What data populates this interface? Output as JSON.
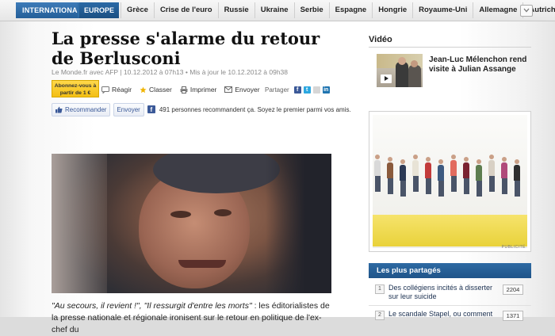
{
  "nav": {
    "section": "INTERNATIONAL",
    "subsection": "EUROPE",
    "links": [
      "Grèce",
      "Crise de l'euro",
      "Russie",
      "Ukraine",
      "Serbie",
      "Espagne",
      "Hongrie",
      "Royaume-Uni",
      "Allemagne",
      "Autriche"
    ],
    "accent": "#245f99"
  },
  "article": {
    "title": "La presse s'alarme du retour de Berlusconi",
    "byline": "Le Monde.fr avec AFP | 10.12.2012 à 07h13 • Mis à jour le 10.12.2012 à 09h38",
    "subscribe": "Abonnez-vous à partir de 1 €",
    "actions": {
      "react": "Réagir",
      "classify": "Classer",
      "print": "Imprimer",
      "send": "Envoyer"
    },
    "share_label": "Partager",
    "facebook": {
      "recommend": "Recommander",
      "send": "Envoyer",
      "count_text": "491 personnes recommandent ça. Soyez le premier parmi vos amis."
    },
    "lead_quote": "\"Au secours, il revient !\", \"Il ressurgit d'entre les morts\"",
    "lead_rest": " : les éditorialistes de la presse nationale et régionale ironisent sur le retour en politique de l'ex-chef du"
  },
  "sidebar": {
    "video": {
      "heading": "Vidéo",
      "title": "Jean-Luc Mélenchon rend visite à Julian Assange"
    },
    "ad_label": "PUBLICITÉ",
    "most_shared": {
      "heading": "Les plus partagés",
      "items": [
        {
          "rank": "1",
          "title": "Des collégiens incités à disserter sur leur suicide",
          "count": "2204"
        },
        {
          "rank": "2",
          "title": "Le scandale Stapel, ou comment",
          "count": "1371"
        }
      ]
    }
  }
}
